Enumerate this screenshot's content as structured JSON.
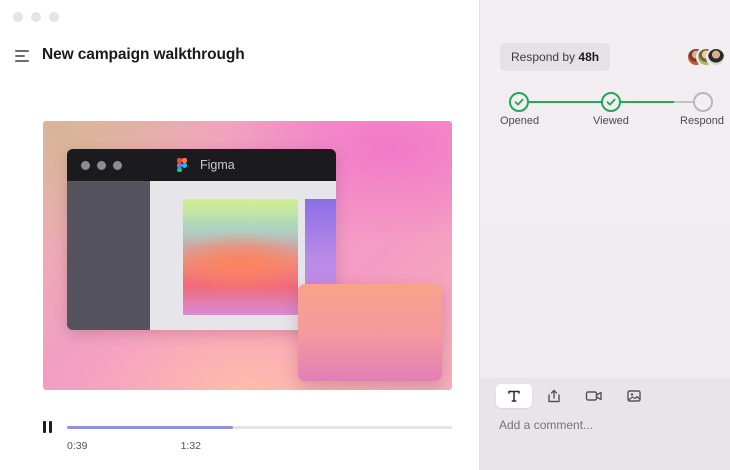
{
  "window": {
    "title": "New campaign walkthrough"
  },
  "player": {
    "preview_app_name": "Figma",
    "current_time": "0:39",
    "duration": "1:32",
    "progress": 0.43,
    "state": "playing"
  },
  "sidebar": {
    "respond_label": "Respond by ",
    "respond_deadline": "48h",
    "steps": [
      {
        "label": "Opened",
        "status": "done"
      },
      {
        "label": "Viewed",
        "status": "done"
      },
      {
        "label": "Respond",
        "status": "pending"
      }
    ],
    "viewer_avatars": [
      "avatar-1",
      "avatar-2",
      "avatar-3"
    ]
  },
  "composer": {
    "tools": [
      {
        "name": "text-icon",
        "active": true
      },
      {
        "name": "upload-icon",
        "active": false
      },
      {
        "name": "video-camera-icon",
        "active": false
      },
      {
        "name": "image-icon",
        "active": false
      }
    ],
    "placeholder": "Add a comment..."
  },
  "colors": {
    "accent_green": "#22a75a",
    "progress": "#8f93e6"
  }
}
